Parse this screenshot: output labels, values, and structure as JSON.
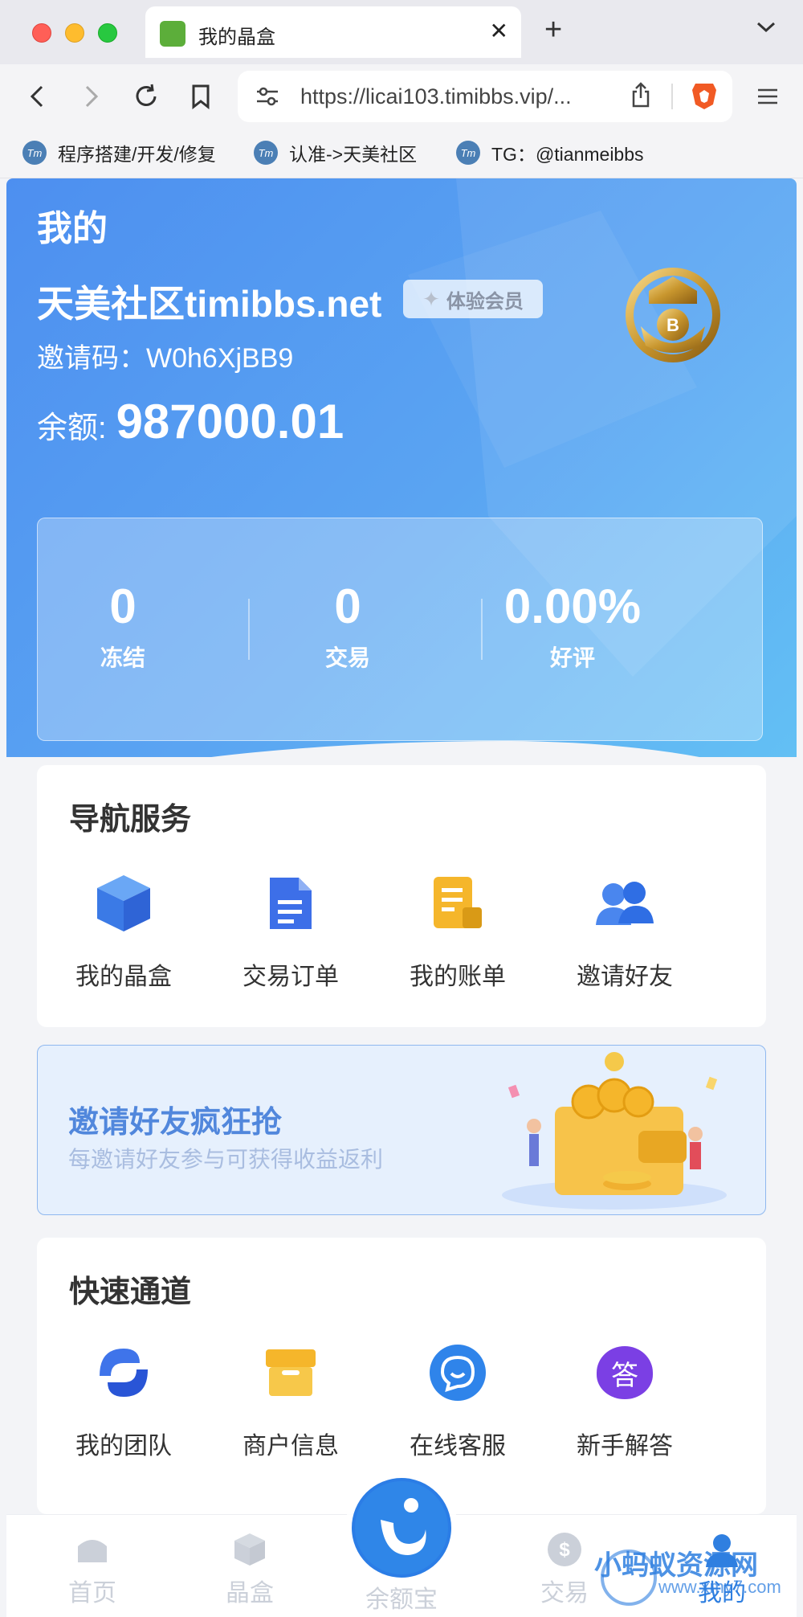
{
  "browser": {
    "tab_title": "我的晶盒",
    "url": "https://licai103.timibbs.vip/...",
    "bookmarks": [
      "程序搭建/开发/修复",
      "认准->天美社区",
      "TG：@tianmeibbs"
    ],
    "bookmark_icon_text": "Tm"
  },
  "hero": {
    "title": "我的",
    "username": "天美社区timibbs.net",
    "member_badge": "体验会员",
    "invite_text": "邀请码：W0h6XjBB9",
    "balance_label": "余额:",
    "balance_value": "987000.01"
  },
  "stats": [
    {
      "value": "0",
      "label": "冻结"
    },
    {
      "value": "0",
      "label": "交易"
    },
    {
      "value": "0.00%",
      "label": "好评"
    }
  ],
  "nav_services": {
    "title": "导航服务",
    "items": [
      {
        "label": "我的晶盒",
        "icon": "cube-icon"
      },
      {
        "label": "交易订单",
        "icon": "document-icon"
      },
      {
        "label": "我的账单",
        "icon": "bill-icon"
      },
      {
        "label": "邀请好友",
        "icon": "users-icon"
      }
    ]
  },
  "banner": {
    "title": "邀请好友疯狂抢",
    "subtitle": "每邀请好友参与可获得收益返利"
  },
  "quick_channels": {
    "title": "快速通道",
    "items": [
      {
        "label": "我的团队",
        "icon": "team-icon"
      },
      {
        "label": "商户信息",
        "icon": "store-icon"
      },
      {
        "label": "在线客服",
        "icon": "chat-icon"
      },
      {
        "label": "新手解答",
        "icon": "answer-icon",
        "glyph": "答"
      }
    ]
  },
  "tabbar": {
    "items": [
      "首页",
      "晶盒",
      "余额宝",
      "交易",
      "我的"
    ]
  },
  "watermark": {
    "text": "小蚂蚁资源网",
    "sub": "www.xmy7.com"
  },
  "colors": {
    "primary": "#4d8ff0",
    "accent_blue": "#3d6fe8",
    "bill_yellow": "#f5b62b",
    "answer_purple": "#7b3fe4"
  }
}
